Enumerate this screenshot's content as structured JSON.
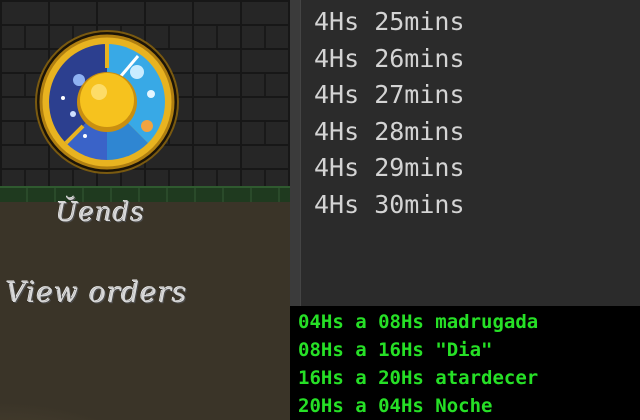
{
  "game": {
    "menu": {
      "items_label": "Ŭends",
      "orders_label": "View orders"
    },
    "clock": {
      "icon": "day-night-clock-icon",
      "colors": {
        "ring": "#e8b320",
        "night": "#2c3f8f",
        "day": "#38a9e6",
        "sun": "#f6c21e"
      }
    }
  },
  "editor": {
    "lines": [
      "4Hs 25mins",
      "4Hs 26mins",
      "4Hs 27mins",
      "4Hs 28mins",
      "4Hs 29mins",
      "4Hs 30mins"
    ]
  },
  "terminal": {
    "lines": [
      "04Hs a 08Hs madrugada",
      "08Hs a 16Hs \"Dia\"",
      "16Hs a 20Hs atardecer",
      "20Hs a 04Hs Noche"
    ],
    "color": "#26e026"
  }
}
